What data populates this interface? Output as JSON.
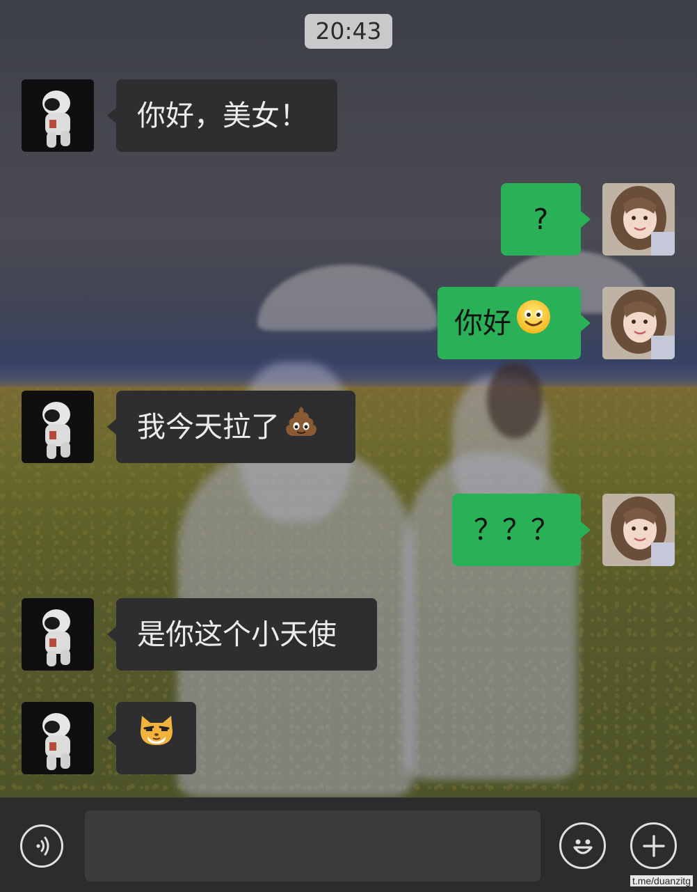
{
  "chat": {
    "timestamp": "20:43",
    "messages": [
      {
        "side": "incoming",
        "text": "你好，美女！",
        "emoji": ""
      },
      {
        "side": "outgoing",
        "text": "?",
        "emoji": ""
      },
      {
        "side": "outgoing",
        "text": "你好",
        "emoji": "smile-emoji"
      },
      {
        "side": "incoming",
        "text": "我今天拉了",
        "emoji": "poop-emoji"
      },
      {
        "side": "outgoing",
        "text": "？？？",
        "emoji": ""
      },
      {
        "side": "incoming",
        "text": "是你这个小天使",
        "emoji": ""
      },
      {
        "side": "incoming",
        "text": "",
        "emoji": "sly-cat-emoji"
      }
    ]
  },
  "input_bar": {
    "voice_icon": "voice-icon",
    "emoji_icon": "emoji-icon",
    "plus_icon": "plus-icon"
  },
  "watermark": "t.me/duanzitg",
  "colors": {
    "incoming_bubble": "#2e2e30",
    "outgoing_bubble": "#2ab158",
    "timestamp_chip": "#c9c9cb"
  }
}
